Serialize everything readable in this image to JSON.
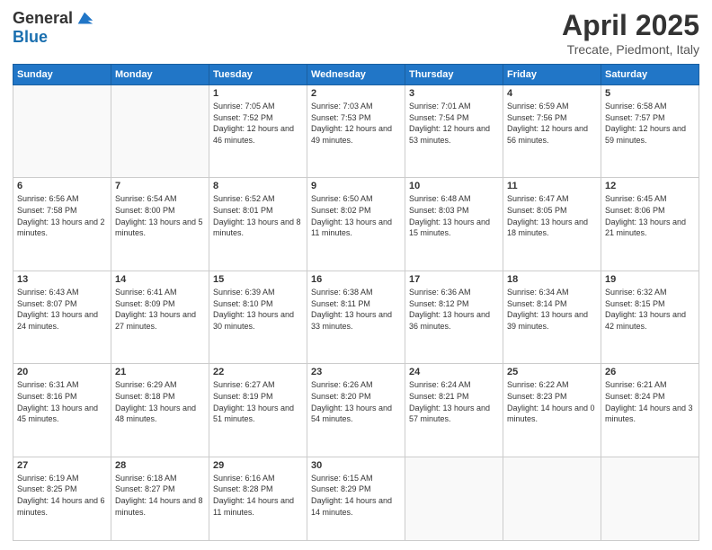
{
  "logo": {
    "general": "General",
    "blue": "Blue"
  },
  "title": {
    "month": "April 2025",
    "location": "Trecate, Piedmont, Italy"
  },
  "weekdays": [
    "Sunday",
    "Monday",
    "Tuesday",
    "Wednesday",
    "Thursday",
    "Friday",
    "Saturday"
  ],
  "weeks": [
    [
      {
        "day": "",
        "info": ""
      },
      {
        "day": "",
        "info": ""
      },
      {
        "day": "1",
        "info": "Sunrise: 7:05 AM\nSunset: 7:52 PM\nDaylight: 12 hours and 46 minutes."
      },
      {
        "day": "2",
        "info": "Sunrise: 7:03 AM\nSunset: 7:53 PM\nDaylight: 12 hours and 49 minutes."
      },
      {
        "day": "3",
        "info": "Sunrise: 7:01 AM\nSunset: 7:54 PM\nDaylight: 12 hours and 53 minutes."
      },
      {
        "day": "4",
        "info": "Sunrise: 6:59 AM\nSunset: 7:56 PM\nDaylight: 12 hours and 56 minutes."
      },
      {
        "day": "5",
        "info": "Sunrise: 6:58 AM\nSunset: 7:57 PM\nDaylight: 12 hours and 59 minutes."
      }
    ],
    [
      {
        "day": "6",
        "info": "Sunrise: 6:56 AM\nSunset: 7:58 PM\nDaylight: 13 hours and 2 minutes."
      },
      {
        "day": "7",
        "info": "Sunrise: 6:54 AM\nSunset: 8:00 PM\nDaylight: 13 hours and 5 minutes."
      },
      {
        "day": "8",
        "info": "Sunrise: 6:52 AM\nSunset: 8:01 PM\nDaylight: 13 hours and 8 minutes."
      },
      {
        "day": "9",
        "info": "Sunrise: 6:50 AM\nSunset: 8:02 PM\nDaylight: 13 hours and 11 minutes."
      },
      {
        "day": "10",
        "info": "Sunrise: 6:48 AM\nSunset: 8:03 PM\nDaylight: 13 hours and 15 minutes."
      },
      {
        "day": "11",
        "info": "Sunrise: 6:47 AM\nSunset: 8:05 PM\nDaylight: 13 hours and 18 minutes."
      },
      {
        "day": "12",
        "info": "Sunrise: 6:45 AM\nSunset: 8:06 PM\nDaylight: 13 hours and 21 minutes."
      }
    ],
    [
      {
        "day": "13",
        "info": "Sunrise: 6:43 AM\nSunset: 8:07 PM\nDaylight: 13 hours and 24 minutes."
      },
      {
        "day": "14",
        "info": "Sunrise: 6:41 AM\nSunset: 8:09 PM\nDaylight: 13 hours and 27 minutes."
      },
      {
        "day": "15",
        "info": "Sunrise: 6:39 AM\nSunset: 8:10 PM\nDaylight: 13 hours and 30 minutes."
      },
      {
        "day": "16",
        "info": "Sunrise: 6:38 AM\nSunset: 8:11 PM\nDaylight: 13 hours and 33 minutes."
      },
      {
        "day": "17",
        "info": "Sunrise: 6:36 AM\nSunset: 8:12 PM\nDaylight: 13 hours and 36 minutes."
      },
      {
        "day": "18",
        "info": "Sunrise: 6:34 AM\nSunset: 8:14 PM\nDaylight: 13 hours and 39 minutes."
      },
      {
        "day": "19",
        "info": "Sunrise: 6:32 AM\nSunset: 8:15 PM\nDaylight: 13 hours and 42 minutes."
      }
    ],
    [
      {
        "day": "20",
        "info": "Sunrise: 6:31 AM\nSunset: 8:16 PM\nDaylight: 13 hours and 45 minutes."
      },
      {
        "day": "21",
        "info": "Sunrise: 6:29 AM\nSunset: 8:18 PM\nDaylight: 13 hours and 48 minutes."
      },
      {
        "day": "22",
        "info": "Sunrise: 6:27 AM\nSunset: 8:19 PM\nDaylight: 13 hours and 51 minutes."
      },
      {
        "day": "23",
        "info": "Sunrise: 6:26 AM\nSunset: 8:20 PM\nDaylight: 13 hours and 54 minutes."
      },
      {
        "day": "24",
        "info": "Sunrise: 6:24 AM\nSunset: 8:21 PM\nDaylight: 13 hours and 57 minutes."
      },
      {
        "day": "25",
        "info": "Sunrise: 6:22 AM\nSunset: 8:23 PM\nDaylight: 14 hours and 0 minutes."
      },
      {
        "day": "26",
        "info": "Sunrise: 6:21 AM\nSunset: 8:24 PM\nDaylight: 14 hours and 3 minutes."
      }
    ],
    [
      {
        "day": "27",
        "info": "Sunrise: 6:19 AM\nSunset: 8:25 PM\nDaylight: 14 hours and 6 minutes."
      },
      {
        "day": "28",
        "info": "Sunrise: 6:18 AM\nSunset: 8:27 PM\nDaylight: 14 hours and 8 minutes."
      },
      {
        "day": "29",
        "info": "Sunrise: 6:16 AM\nSunset: 8:28 PM\nDaylight: 14 hours and 11 minutes."
      },
      {
        "day": "30",
        "info": "Sunrise: 6:15 AM\nSunset: 8:29 PM\nDaylight: 14 hours and 14 minutes."
      },
      {
        "day": "",
        "info": ""
      },
      {
        "day": "",
        "info": ""
      },
      {
        "day": "",
        "info": ""
      }
    ]
  ]
}
